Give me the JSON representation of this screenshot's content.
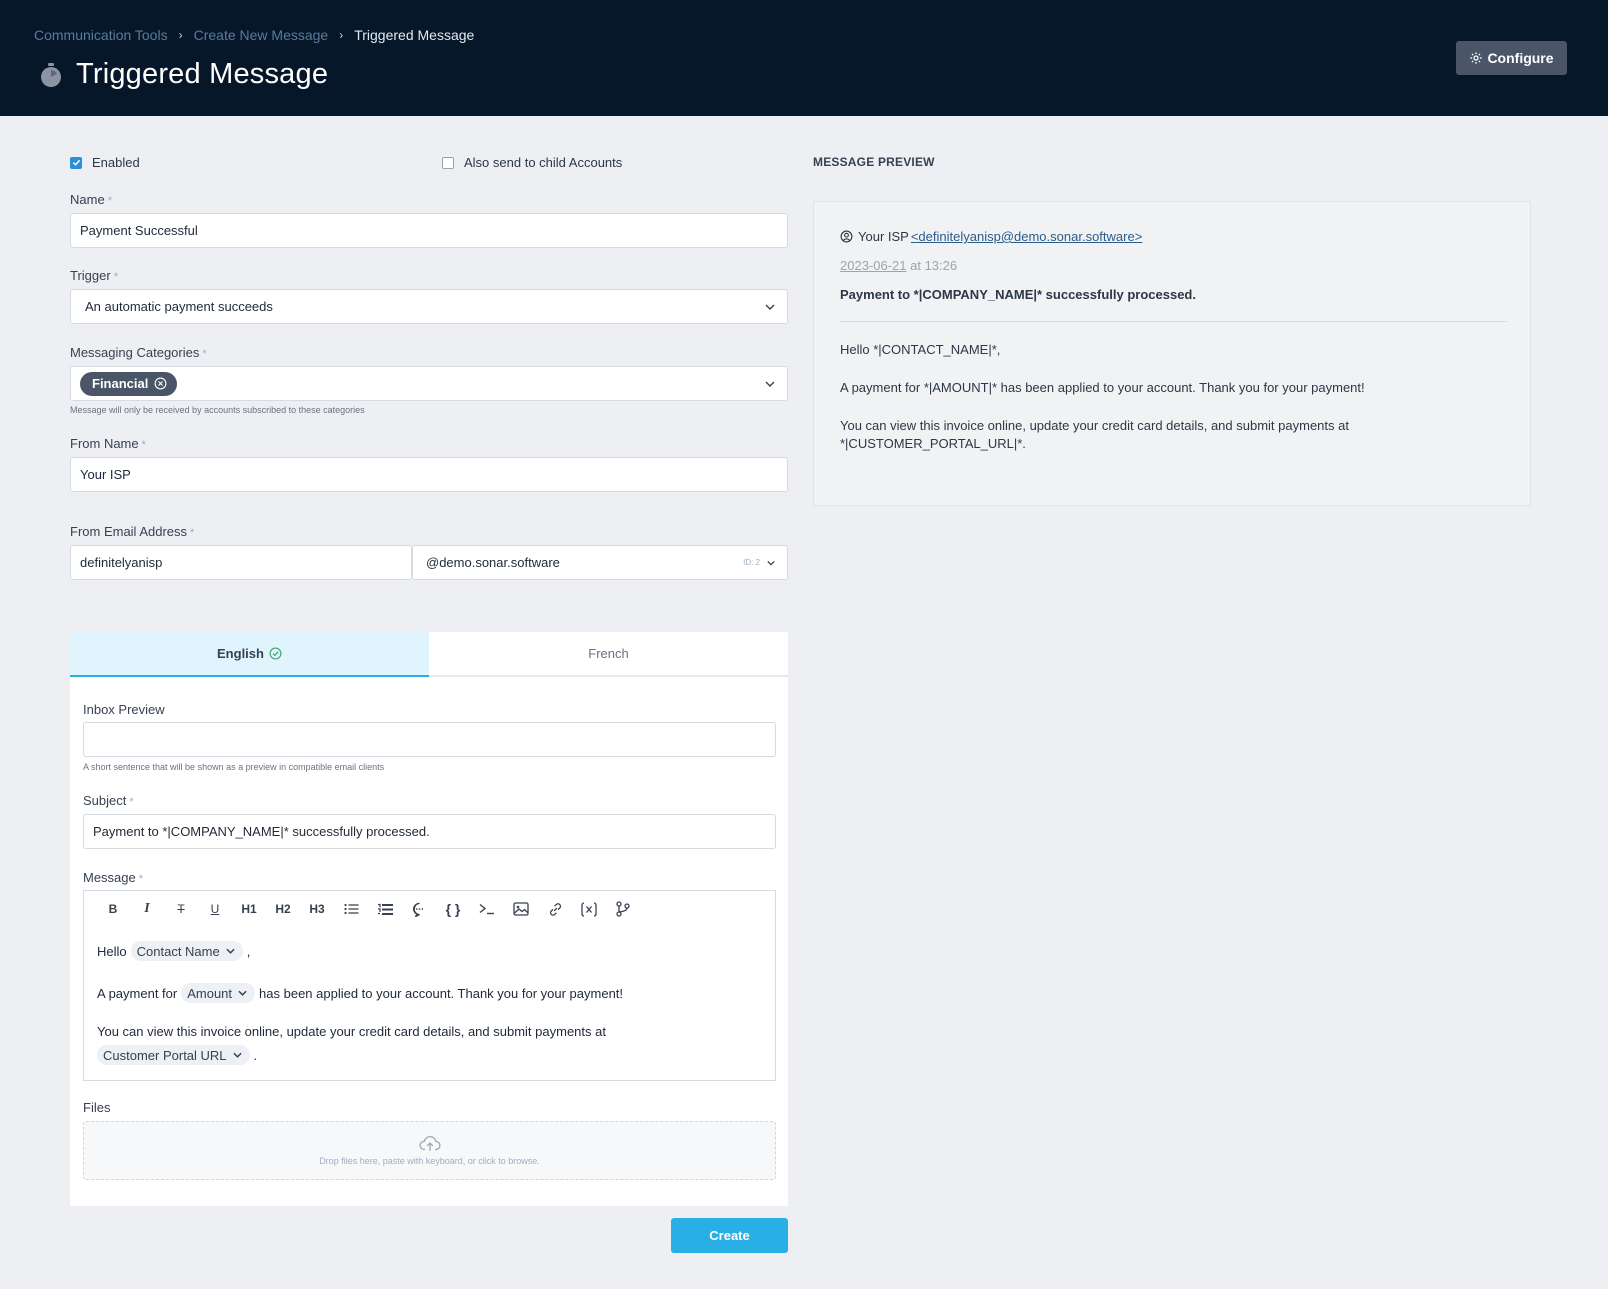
{
  "header": {
    "breadcrumbs": [
      "Communication Tools",
      "Create New Message",
      "Triggered Message"
    ],
    "title": "Triggered Message",
    "configure_label": "Configure"
  },
  "form": {
    "enabled_label": "Enabled",
    "enabled": true,
    "child_accounts_label": "Also send to child Accounts",
    "child_accounts": false,
    "name_label": "Name",
    "name_value": "Payment Successful",
    "trigger_label": "Trigger",
    "trigger_value": "An automatic payment succeeds",
    "categories_label": "Messaging Categories",
    "categories": [
      "Financial"
    ],
    "categories_help": "Message will only be received by accounts subscribed to these categories",
    "from_name_label": "From Name",
    "from_name_value": "Your ISP",
    "from_email_label": "From Email Address",
    "from_email_local": "definitelyanisp",
    "from_email_domain": "@demo.sonar.software",
    "from_email_domain_id": "ID: 2",
    "required_mark": "*"
  },
  "tabs": [
    {
      "label": "English",
      "active": true,
      "complete": true
    },
    {
      "label": "French",
      "active": false,
      "complete": false
    }
  ],
  "content": {
    "inbox_preview_label": "Inbox Preview",
    "inbox_preview_value": "",
    "inbox_preview_help": "A short sentence that will be shown as a preview in compatible email clients",
    "subject_label": "Subject",
    "subject_value": "Payment to *|COMPANY_NAME|* successfully processed.",
    "message_label": "Message",
    "toolbar": [
      "bold-icon",
      "italic-icon",
      "strikethrough-icon",
      "underline-icon",
      "H1",
      "H2",
      "H3",
      "bullet-list-icon",
      "ordered-list-icon",
      "comment-icon",
      "braces-icon",
      "terminal-icon",
      "image-icon",
      "link-icon",
      "variable-icon",
      "branch-icon"
    ],
    "editor": {
      "l1_before": "Hello",
      "l1_var": "Contact Name",
      "l1_after": ",",
      "l2_before": "A payment for",
      "l2_var": "Amount",
      "l2_after": "has been applied to your account. Thank you for your payment!",
      "l3_text": "You can view this invoice online, update your credit card details, and submit payments at",
      "l4_var": "Customer Portal URL",
      "l4_after": "."
    },
    "files_label": "Files",
    "dropzone_text": "Drop files here, paste with keyboard, or click to browse.",
    "create_label": "Create"
  },
  "preview": {
    "heading": "MESSAGE PREVIEW",
    "from_name": "Your ISP",
    "from_email": "<definitelyanisp@demo.sonar.software>",
    "date": "2023-06-21",
    "time": "at 13:26",
    "subject": "Payment to *|COMPANY_NAME|* successfully processed.",
    "body_1": "Hello *|CONTACT_NAME|*,",
    "body_2": "A payment for *|AMOUNT|* has been applied to your account. Thank you for your payment!",
    "body_3a": "You can view this invoice online, update your credit card details, and submit payments at",
    "body_3b": "*|CUSTOMER_PORTAL_URL|*."
  },
  "colors": {
    "header_bg": "#06172a",
    "accent": "#2aaee6",
    "tag_bg": "#4a5568",
    "page_bg": "#edeff3"
  }
}
